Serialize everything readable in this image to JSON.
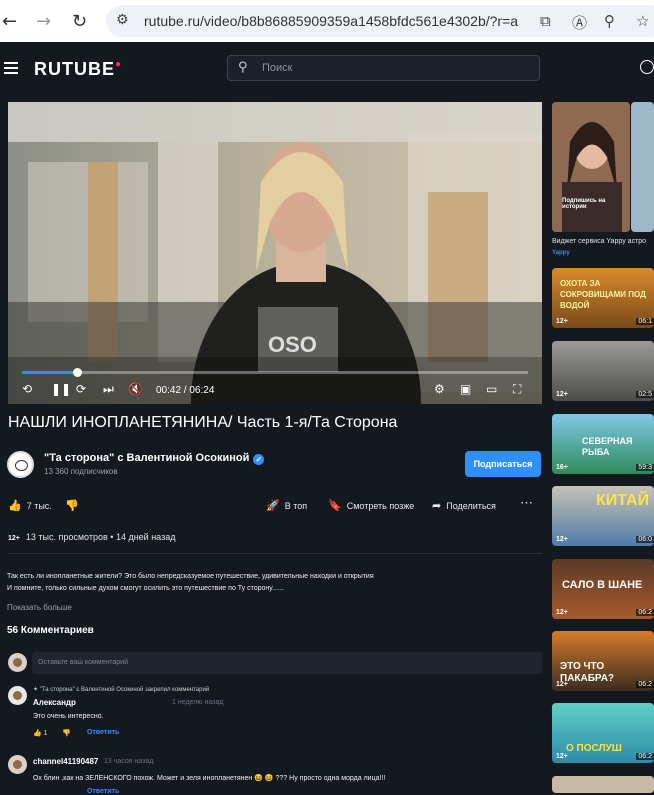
{
  "browser": {
    "back_icon": "←",
    "forward_icon": "→",
    "reload_icon": "↻",
    "url": "rutube.ru/video/b8b86885909359a1458bfdc561e4302b/?r=a",
    "icons": [
      "external-link-icon",
      "translate-icon",
      "zoom-icon",
      "star-icon"
    ]
  },
  "header": {
    "logo": "RUTUBE",
    "search_placeholder": "Поиск"
  },
  "player": {
    "current_time": "00:42",
    "duration": "06:24",
    "time_display": "00:42 / 06:24",
    "progress": 0.109
  },
  "video": {
    "title": "НАШЛИ ИНОПЛАНЕТЯНИНА/ Часть 1-я/Та Сторона",
    "channel_name": "\"Та сторона\" с Валентиной Осокиной",
    "subscribers": "13 360 подписчиков",
    "subscribe_label": "Подписаться",
    "likes": "7 тыс.",
    "to_top": "В топ",
    "watch_later": "Смотреть позже",
    "share": "Поделиться",
    "age_rating": "12+",
    "views": "13 тыс. просмотров",
    "published": "14 дней назад",
    "description_line1": "Так есть ли инопланетные жители? Это было непредсказуемое путешествие, удивительные находки и открытия",
    "description_line2": "И помните, только сильные духом смогут осилить это путешествие по Ту сторону......",
    "show_more": "Показать больше"
  },
  "comments": {
    "count_label": "56 Комментариев",
    "input_placeholder": "Оставьте ваш комментарий",
    "pinned_note": "\"Та сторона\" с Валентиной Осокиной закрепил комментарий",
    "items": [
      {
        "author": "Александр",
        "time": "1 неделю назад",
        "text": "Это очень интересно.",
        "likes": "1",
        "reply": "Ответить"
      },
      {
        "author": "channel41190487",
        "time": "13 часов назад",
        "text": "Ох блин ,как на ЗЕЛЕНСКОГО похож. Может и зеля инопланетянен 😆 😆 ???  Ну просто одна морда лица!!!",
        "reply": "Ответить"
      }
    ]
  },
  "sidebar": {
    "widget_title": "Виджет сервиса Yappy астро",
    "widget_sub": "Yappy",
    "widget_caption": "Подпишись на истории",
    "items": [
      {
        "label": "ОХОТА ЗА СОКРОВИЩАМИ ПОД ВОДОЙ",
        "age": "12+",
        "duration": "06:1"
      },
      {
        "label": "",
        "age": "12+",
        "duration": "02:5"
      },
      {
        "label": "СЕВЕРНАЯ РЫБА",
        "age": "16+",
        "duration": "59:3"
      },
      {
        "label": "КИТАЙ",
        "age": "12+",
        "duration": "06:0"
      },
      {
        "label": "САЛО В ШАНЕ",
        "age": "12+",
        "duration": "06:2"
      },
      {
        "label": "ЭТО ЧТО ПАКАБРА?",
        "age": "12+",
        "duration": "06:2"
      },
      {
        "label": "О ПОСЛУШ",
        "age": "12+",
        "duration": "06:2"
      }
    ]
  },
  "colors": {
    "background": "#14191f",
    "accent": "#2f8fff",
    "logo_dot": "#ff2d55"
  }
}
